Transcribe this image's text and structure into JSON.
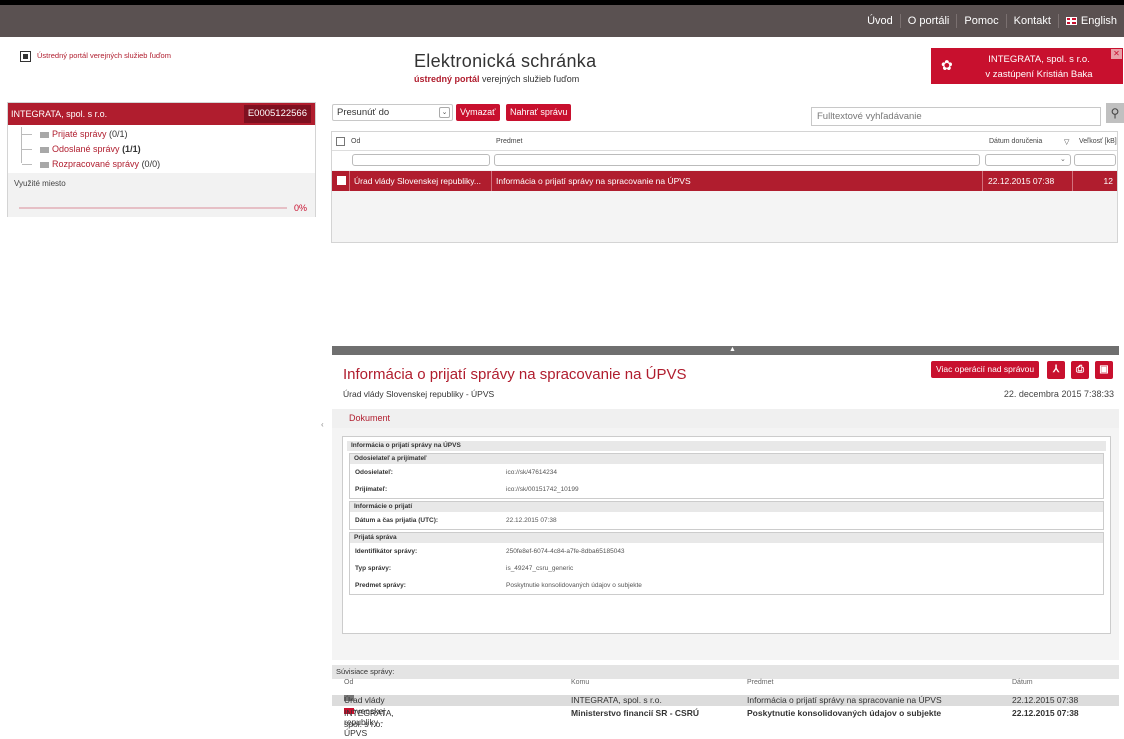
{
  "topnav": {
    "items": [
      "Úvod",
      "O portáli",
      "Pomoc",
      "Kontakt"
    ],
    "english": "English"
  },
  "header": {
    "logo_text": "Ústredný portál verejných služieb ľuďom",
    "brand_title": "Elektronická schránka",
    "brand_sub_bold": "ústredný portál",
    "brand_sub_rest": " verejných služieb ľuďom",
    "user_line1": "INTEGRATA, spol. s r.o.",
    "user_line2": "v zastúpení Kristián Baka"
  },
  "sidebar": {
    "account_name": "INTEGRATA, spol. s r.o.",
    "account_id": "E0005122566",
    "folders": [
      {
        "label": "Prijaté správy",
        "count": "(0/1)"
      },
      {
        "label": "Odoslané správy",
        "count": "(1/1)"
      },
      {
        "label": "Rozpracované správy",
        "count": "(0/0)"
      }
    ],
    "usage_label": "Využité miesto",
    "usage_pct": "0%",
    "usage_value": 0
  },
  "toolbar": {
    "move_select": "Presunúť do",
    "delete_label": "Vymazať",
    "upload_label": "Nahrať správu",
    "search_placeholder": "Fulltextové vyhľadávanie"
  },
  "grid": {
    "columns": [
      "Od",
      "Predmet",
      "Dátum doručenia",
      "Veľkosť [kB]"
    ],
    "rows": [
      {
        "from": "Úrad vlády Slovenskej republiky...",
        "subject": "Informácia o prijatí správy na spracovanie na ÚPVS",
        "date": "22.12.2015 07:38",
        "size": "12"
      }
    ]
  },
  "detail": {
    "title": "Informácia o prijatí správy na spracovanie na ÚPVS",
    "sender": "Úrad vlády Slovenskej republiky - ÚPVS",
    "date": "22. decembra 2015 7:38:33",
    "more_ops": "Viac operácií nad správou",
    "tab": "Dokument",
    "doc": {
      "title": "Informácia o prijatí správy na ÚPVS",
      "sections": [
        {
          "heading": "Odosielateľ a prijímateľ",
          "rows": [
            {
              "k": "Odosielateľ:",
              "v": "ico://sk/47614234"
            },
            {
              "k": "Prijímateľ:",
              "v": "ico://sk/00151742_10199"
            }
          ]
        },
        {
          "heading": "Informácie o prijatí",
          "rows": [
            {
              "k": "Dátum a čas prijatia (UTC):",
              "v": "22.12.2015 07:38"
            }
          ]
        },
        {
          "heading": "Prijatá správa",
          "rows": [
            {
              "k": "Identifikátor správy:",
              "v": "250fe8ef-6074-4c84-a7fe-8dba65185043"
            },
            {
              "k": "Typ správy:",
              "v": "is_49247_csru_generic"
            },
            {
              "k": "Predmet správy:",
              "v": "Poskytnutie konsolidovaných údajov o subjekte"
            }
          ]
        }
      ]
    }
  },
  "related": {
    "title": "Súvisiace správy:",
    "columns": [
      "Od",
      "Komu",
      "Predmet",
      "Dátum"
    ],
    "rows": [
      {
        "from": "Úrad vlády Slovenskej republiky - ÚPVS",
        "to": "INTEGRATA, spol. s r.o.",
        "subject": "Informácia o prijatí správy na spracovanie na ÚPVS",
        "date": "22.12.2015 07:38"
      },
      {
        "from": "INTEGRATA, spol. s r.o.",
        "to": "Ministerstvo financií SR - CSRÚ",
        "subject": "Poskytnutie konsolidovaných údajov o subjekte",
        "date": "22.12.2015 07:38"
      }
    ]
  }
}
